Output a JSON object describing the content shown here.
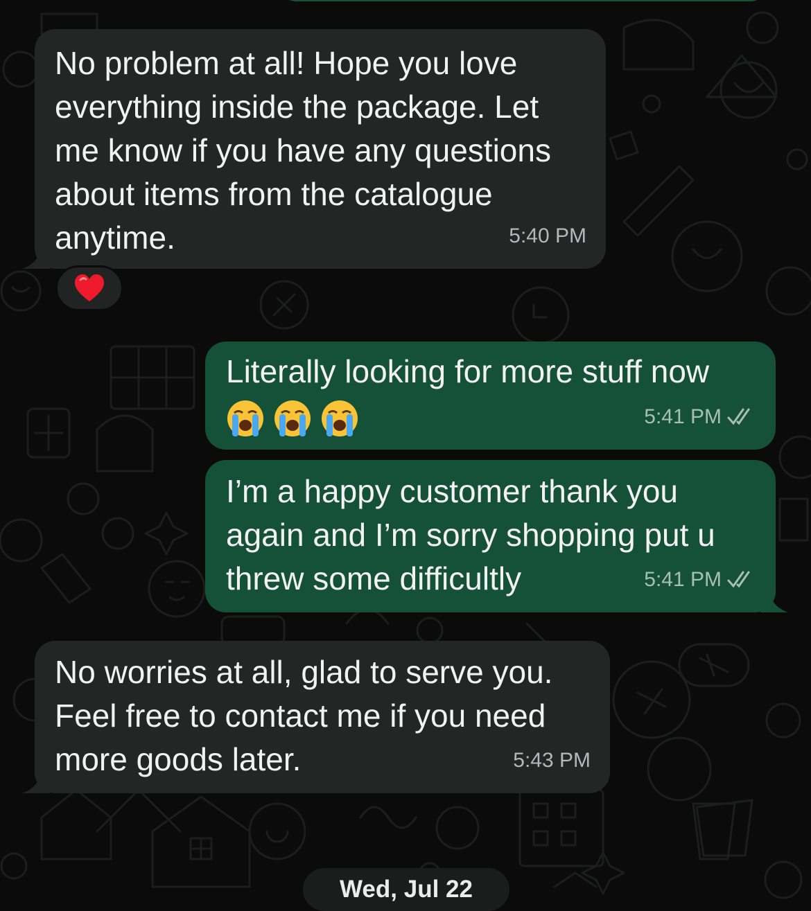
{
  "chat": {
    "messages": [
      {
        "direction": "incoming",
        "text": "No problem at all! Hope you love\neverything inside the package. Let\nme know if you have any questions\nabout items from the catalogue\nanytime.",
        "time": "5:40 PM",
        "reaction": "heart-emoji"
      },
      {
        "direction": "outgoing",
        "text": "Literally looking for more stuff now",
        "emojis": [
          "loudly-crying-face-emoji",
          "loudly-crying-face-emoji",
          "loudly-crying-face-emoji"
        ],
        "time": "5:41 PM",
        "status": "read"
      },
      {
        "direction": "outgoing",
        "text": "I’m a happy customer thank you\nagain and I’m sorry shopping put u\nthrew some difficultly",
        "time": "5:41 PM",
        "status": "read"
      },
      {
        "direction": "incoming",
        "text": "No worries at all, glad to serve you.\nFeel free to contact me if you need\nmore goods later.",
        "time": "5:43 PM"
      }
    ],
    "date_separator": "Wed, Jul 22"
  },
  "colors": {
    "background": "#0b0b0b",
    "incoming_bubble": "#242626",
    "outgoing_bubble": "#155038",
    "read_ticks": "#a9bfb4"
  }
}
